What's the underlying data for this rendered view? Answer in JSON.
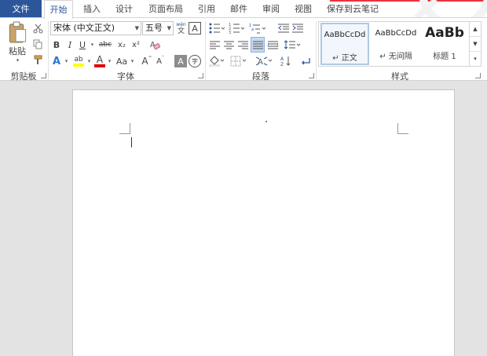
{
  "tabs": {
    "file": "文件",
    "home": "开始",
    "insert": "插入",
    "design": "设计",
    "layout": "页面布局",
    "references": "引用",
    "mailings": "邮件",
    "review": "审阅",
    "view": "视图",
    "evernote": "保存到云笔记"
  },
  "clipboard": {
    "paste_label": "粘贴",
    "group_label": "剪贴板"
  },
  "font": {
    "name": "宋体 (中文正文)",
    "size": "五号",
    "pinyin_glyph": "wén",
    "pinyin_char": "文",
    "border_char": "A",
    "bold": "B",
    "italic": "I",
    "underline": "U",
    "strike": "abc",
    "subscript": "x₂",
    "superscript": "x²",
    "text_effect": "A",
    "highlight": "ab",
    "font_color": "A",
    "change_case": "Aa",
    "grow": "A",
    "shrink": "A",
    "shading_char": "A",
    "enclose_char": "字",
    "group_label": "字体"
  },
  "paragraph": {
    "group_label": "段落"
  },
  "styles": {
    "items": [
      {
        "sample": "AaBbCcDd",
        "name": "↵ 正文"
      },
      {
        "sample": "AaBbCcDd",
        "name": "↵ 无间隔"
      },
      {
        "sample": "AaBb",
        "name": "标题 1"
      }
    ],
    "group_label": "样式"
  },
  "colors": {
    "accent": "#2b579a",
    "highlight": "#ffff00",
    "font_color": "#e00000"
  }
}
